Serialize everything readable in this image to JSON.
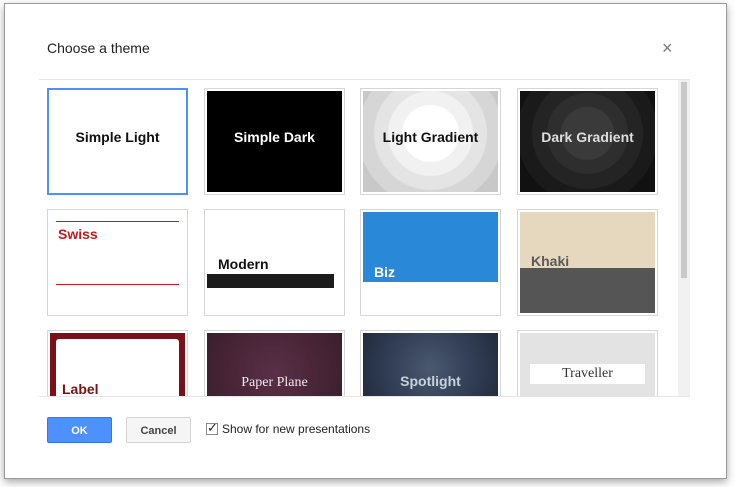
{
  "dialog": {
    "title": "Choose a theme",
    "close_icon": "close-icon",
    "close_symbol": "×"
  },
  "themes": [
    {
      "label": "Simple Light",
      "selected": true
    },
    {
      "label": "Simple Dark"
    },
    {
      "label": "Light Gradient"
    },
    {
      "label": "Dark Gradient"
    },
    {
      "label": "Swiss"
    },
    {
      "label": "Modern"
    },
    {
      "label": "Biz"
    },
    {
      "label": "Khaki"
    },
    {
      "label": "Label"
    },
    {
      "label": "Paper Plane"
    },
    {
      "label": "Spotlight"
    },
    {
      "label": "Traveller"
    }
  ],
  "footer": {
    "ok_label": "OK",
    "cancel_label": "Cancel",
    "checkbox_checked": true,
    "checkbox_label": "Show for new presentations"
  },
  "colors": {
    "primary": "#4d90fe",
    "swiss_red": "#c3181d",
    "biz_blue": "#2a88d9",
    "label_maroon": "#7a1018"
  }
}
